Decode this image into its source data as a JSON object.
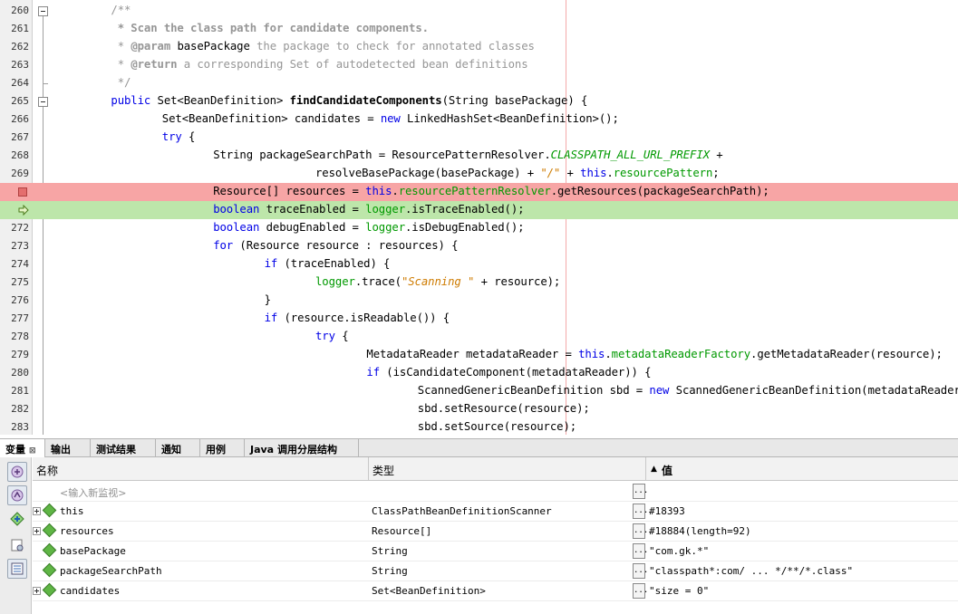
{
  "editor": {
    "lines": [
      {
        "num": "260",
        "indent": 2,
        "tokens": [
          {
            "t": "/**",
            "c": "cm"
          }
        ]
      },
      {
        "num": "261",
        "indent": 2,
        "tokens": [
          {
            "t": " * Scan the class path for candidate components.",
            "c": "cmb"
          }
        ]
      },
      {
        "num": "262",
        "indent": 2,
        "tokens": [
          {
            "t": " * ",
            "c": "cm"
          },
          {
            "t": "@param",
            "c": "cmb"
          },
          {
            "t": " basePackage",
            "c": ""
          },
          {
            "t": " the package to check for annotated classes",
            "c": "cm"
          }
        ]
      },
      {
        "num": "263",
        "indent": 2,
        "tokens": [
          {
            "t": " * ",
            "c": "cm"
          },
          {
            "t": "@return",
            "c": "cmb"
          },
          {
            "t": " a corresponding Set of autodetected bean definitions",
            "c": "cm"
          }
        ]
      },
      {
        "num": "264",
        "indent": 2,
        "tokens": [
          {
            "t": " */",
            "c": "cm"
          }
        ]
      },
      {
        "num": "265",
        "indent": 2,
        "tokens": [
          {
            "t": "public",
            "c": "kw"
          },
          {
            "t": " Set<BeanDefinition> ",
            "c": ""
          },
          {
            "t": "findCandidateComponents",
            "c": "fn"
          },
          {
            "t": "(String basePackage) {",
            "c": ""
          }
        ]
      },
      {
        "num": "266",
        "indent": 4,
        "tokens": [
          {
            "t": "Set<BeanDefinition> candidates = ",
            "c": ""
          },
          {
            "t": "new",
            "c": "kw"
          },
          {
            "t": " LinkedHashSet<BeanDefinition>();",
            "c": ""
          }
        ]
      },
      {
        "num": "267",
        "indent": 4,
        "tokens": [
          {
            "t": "try",
            "c": "kw"
          },
          {
            "t": " {",
            "c": ""
          }
        ]
      },
      {
        "num": "268",
        "indent": 6,
        "tokens": [
          {
            "t": "String packageSearchPath = ResourcePatternResolver.",
            "c": ""
          },
          {
            "t": "CLASSPATH_ALL_URL_PREFIX",
            "c": "cst"
          },
          {
            "t": " +",
            "c": ""
          }
        ]
      },
      {
        "num": "269",
        "indent": 10,
        "tokens": [
          {
            "t": "resolveBasePackage(basePackage) + ",
            "c": ""
          },
          {
            "t": "\"/\"",
            "c": "str"
          },
          {
            "t": " + ",
            "c": ""
          },
          {
            "t": "this",
            "c": "kw"
          },
          {
            "t": ".",
            "c": ""
          },
          {
            "t": "resourcePattern",
            "c": "fld"
          },
          {
            "t": ";",
            "c": ""
          }
        ]
      },
      {
        "num": "",
        "indent": 6,
        "marker": "breakpoint",
        "tokens": [
          {
            "t": "Resource[] resources = ",
            "c": ""
          },
          {
            "t": "this",
            "c": "kw"
          },
          {
            "t": ".",
            "c": ""
          },
          {
            "t": "resourcePatternResolver",
            "c": "fld"
          },
          {
            "t": ".getResources(packageSearchPath);",
            "c": ""
          }
        ]
      },
      {
        "num": "",
        "indent": 6,
        "marker": "current",
        "tokens": [
          {
            "t": "boolean",
            "c": "kw"
          },
          {
            "t": " traceEnabled = ",
            "c": ""
          },
          {
            "t": "logger",
            "c": "fld"
          },
          {
            "t": ".isTraceEnabled();",
            "c": ""
          }
        ]
      },
      {
        "num": "272",
        "indent": 6,
        "tokens": [
          {
            "t": "boolean",
            "c": "kw"
          },
          {
            "t": " debugEnabled = ",
            "c": ""
          },
          {
            "t": "logger",
            "c": "fld"
          },
          {
            "t": ".isDebugEnabled();",
            "c": ""
          }
        ]
      },
      {
        "num": "273",
        "indent": 6,
        "tokens": [
          {
            "t": "for",
            "c": "kw"
          },
          {
            "t": " (Resource resource : resources) {",
            "c": ""
          }
        ]
      },
      {
        "num": "274",
        "indent": 8,
        "tokens": [
          {
            "t": "if",
            "c": "kw"
          },
          {
            "t": " (traceEnabled) {",
            "c": ""
          }
        ]
      },
      {
        "num": "275",
        "indent": 10,
        "tokens": [
          {
            "t": "logger",
            "c": "fld"
          },
          {
            "t": ".trace(",
            "c": ""
          },
          {
            "t": "\"Scanning \"",
            "c": "str"
          },
          {
            "t": " + resource);",
            "c": ""
          }
        ]
      },
      {
        "num": "276",
        "indent": 8,
        "tokens": [
          {
            "t": "}",
            "c": ""
          }
        ]
      },
      {
        "num": "277",
        "indent": 8,
        "tokens": [
          {
            "t": "if",
            "c": "kw"
          },
          {
            "t": " (resource.isReadable()) {",
            "c": ""
          }
        ]
      },
      {
        "num": "278",
        "indent": 10,
        "tokens": [
          {
            "t": "try",
            "c": "kw"
          },
          {
            "t": " {",
            "c": ""
          }
        ]
      },
      {
        "num": "279",
        "indent": 12,
        "tokens": [
          {
            "t": "MetadataReader metadataReader = ",
            "c": ""
          },
          {
            "t": "this",
            "c": "kw"
          },
          {
            "t": ".",
            "c": ""
          },
          {
            "t": "metadataReaderFactory",
            "c": "fld"
          },
          {
            "t": ".getMetadataReader(resource);",
            "c": ""
          }
        ]
      },
      {
        "num": "280",
        "indent": 12,
        "tokens": [
          {
            "t": "if",
            "c": "kw"
          },
          {
            "t": " (isCandidateComponent(metadataReader)) {",
            "c": ""
          }
        ]
      },
      {
        "num": "281",
        "indent": 14,
        "tokens": [
          {
            "t": "ScannedGenericBeanDefinition sbd = ",
            "c": ""
          },
          {
            "t": "new",
            "c": "kw"
          },
          {
            "t": " ScannedGenericBeanDefinition(metadataReader);",
            "c": ""
          }
        ]
      },
      {
        "num": "282",
        "indent": 14,
        "tokens": [
          {
            "t": "sbd.setResource(resource);",
            "c": ""
          }
        ]
      },
      {
        "num": "283",
        "indent": 14,
        "tokens": [
          {
            "t": "sbd.setSource(resource);",
            "c": ""
          }
        ]
      }
    ]
  },
  "tabs": [
    {
      "label": "变量",
      "close": "⊠",
      "active": true
    },
    {
      "label": "输出"
    },
    {
      "label": "测试结果"
    },
    {
      "label": "通知"
    },
    {
      "label": "用例"
    },
    {
      "label": "Java 调用分层结构"
    }
  ],
  "variables": {
    "headers": {
      "name": "名称",
      "type": "类型",
      "value": "值",
      "sort_indicator": "▲"
    },
    "new_watch_placeholder": "<输入新监视>",
    "button_label": "...",
    "rows": [
      {
        "name": "this",
        "type": "ClassPathBeanDefinitionScanner",
        "value": "#18393",
        "expandable": true
      },
      {
        "name": "resources",
        "type": "Resource[]",
        "value": "#18884(length=92)",
        "expandable": true
      },
      {
        "name": "basePackage",
        "type": "String",
        "value": "\"com.gk.*\"",
        "expandable": false
      },
      {
        "name": "packageSearchPath",
        "type": "String",
        "value": "\"classpath*:com/ ... */**/*.class\"",
        "expandable": false
      },
      {
        "name": "candidates",
        "type": "Set<BeanDefinition>",
        "value": "\"size = 0\"",
        "expandable": true
      }
    ]
  },
  "colors": {
    "breakpoint_line": "#f7a5a5",
    "current_line": "#bde6aa",
    "keyword": "#0000e6",
    "field": "#009900",
    "string": "#ce7b00",
    "comment": "#969696"
  },
  "icons": [
    "fold-icon",
    "breakpoint-icon",
    "program-counter-icon",
    "expand-icon",
    "variable-icon",
    "debug-toolbar-icons"
  ]
}
